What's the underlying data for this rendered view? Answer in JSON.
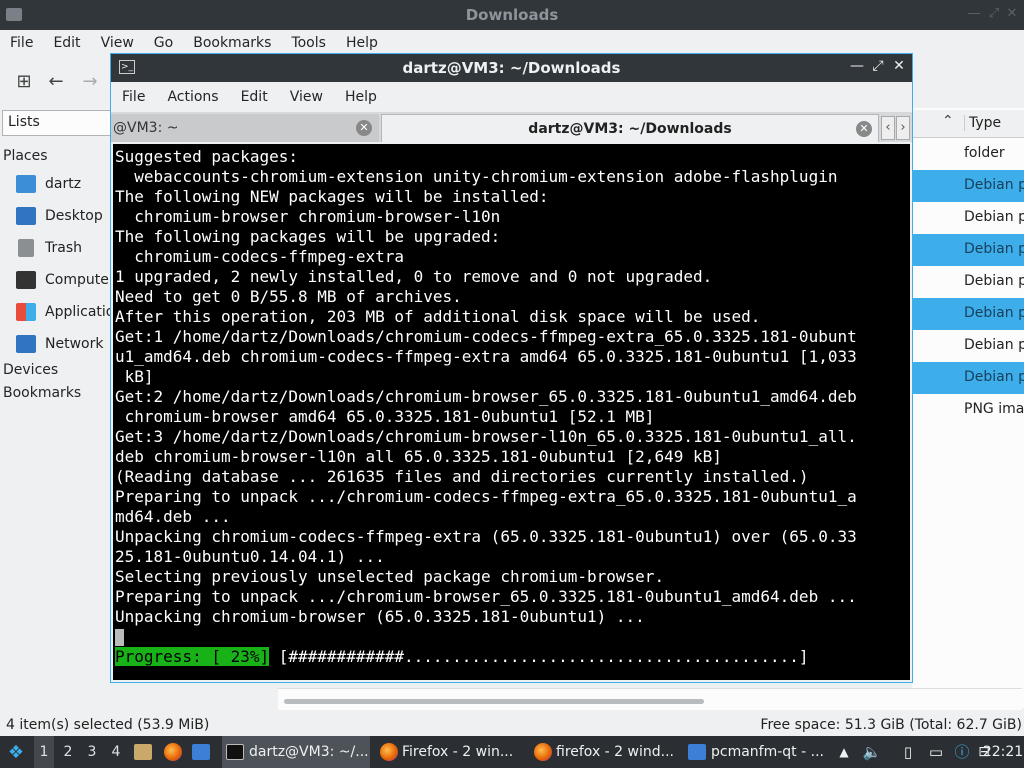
{
  "fm": {
    "title": "Downloads",
    "menu": [
      "File",
      "Edit",
      "View",
      "Go",
      "Bookmarks",
      "Tools",
      "Help"
    ],
    "lists_combo": "Lists",
    "places_heading": "Places",
    "places": [
      {
        "label": "dartz",
        "icon": "home-folder-icon",
        "color": "#3c8ed6"
      },
      {
        "label": "Desktop",
        "icon": "desktop-icon",
        "color": "#2f75c0"
      },
      {
        "label": "Trash",
        "icon": "trash-icon",
        "color": "#8a8f94"
      },
      {
        "label": "Computer",
        "icon": "computer-icon",
        "color": "#333333"
      },
      {
        "label": "Applications",
        "icon": "applications-icon",
        "color": "#e74c3c"
      },
      {
        "label": "Network",
        "icon": "network-icon",
        "color": "#2f75c0"
      }
    ],
    "devices_heading": "Devices",
    "bookmarks_heading": "Bookmarks",
    "type_header": "Type",
    "rows": [
      {
        "type": "folder",
        "selected": false
      },
      {
        "type": "Debian p",
        "selected": true
      },
      {
        "type": "Debian p",
        "selected": false
      },
      {
        "type": "Debian p",
        "selected": true
      },
      {
        "type": "Debian p",
        "selected": false
      },
      {
        "type": "Debian p",
        "selected": true
      },
      {
        "type": "Debian p",
        "selected": false
      },
      {
        "type": "Debian p",
        "selected": true
      },
      {
        "type": "PNG ima",
        "selected": false
      }
    ],
    "status_left": "4 item(s) selected (53.9 MiB)",
    "status_right": "Free space: 51.3 GiB (Total: 62.7 GiB)"
  },
  "term": {
    "title": "dartz@VM3: ~/Downloads",
    "menu": [
      "File",
      "Actions",
      "Edit",
      "View",
      "Help"
    ],
    "tab_inactive": "@VM3: ~",
    "tab_active": "dartz@VM3: ~/Downloads",
    "lines": [
      "Suggested packages:",
      "  webaccounts-chromium-extension unity-chromium-extension adobe-flashplugin",
      "The following NEW packages will be installed:",
      "  chromium-browser chromium-browser-l10n",
      "The following packages will be upgraded:",
      "  chromium-codecs-ffmpeg-extra",
      "1 upgraded, 2 newly installed, 0 to remove and 0 not upgraded.",
      "Need to get 0 B/55.8 MB of archives.",
      "After this operation, 203 MB of additional disk space will be used.",
      "Get:1 /home/dartz/Downloads/chromium-codecs-ffmpeg-extra_65.0.3325.181-0ubunt",
      "u1_amd64.deb chromium-codecs-ffmpeg-extra amd64 65.0.3325.181-0ubuntu1 [1,033",
      " kB]",
      "Get:2 /home/dartz/Downloads/chromium-browser_65.0.3325.181-0ubuntu1_amd64.deb",
      " chromium-browser amd64 65.0.3325.181-0ubuntu1 [52.1 MB]",
      "Get:3 /home/dartz/Downloads/chromium-browser-l10n_65.0.3325.181-0ubuntu1_all.",
      "deb chromium-browser-l10n all 65.0.3325.181-0ubuntu1 [2,649 kB]",
      "(Reading database ... 261635 files and directories currently installed.)",
      "Preparing to unpack .../chromium-codecs-ffmpeg-extra_65.0.3325.181-0ubuntu1_a",
      "md64.deb ...",
      "Unpacking chromium-codecs-ffmpeg-extra (65.0.3325.181-0ubuntu1) over (65.0.33",
      "25.181-0ubuntu0.14.04.1) ...",
      "Selecting previously unselected package chromium-browser.",
      "Preparing to unpack .../chromium-browser_65.0.3325.181-0ubuntu1_amd64.deb ...",
      "Unpacking chromium-browser (65.0.3325.181-0ubuntu1) ..."
    ],
    "progress_label": "Progress: [ 23%]",
    "progress_percent": 23,
    "progress_bar": " [############.........................................]",
    "colors": {
      "background": "#000000",
      "text": "#ffffff",
      "progress_bg": "#18b218"
    }
  },
  "taskbar": {
    "desktops": [
      "1",
      "2",
      "3",
      "4"
    ],
    "current_desktop": "1",
    "tasks": [
      {
        "label": "dartz@VM3: ~/...",
        "icon": "terminal-icon",
        "active": true
      },
      {
        "label": "Firefox - 2 win...",
        "icon": "firefox-icon",
        "active": false
      },
      {
        "label": "firefox - 2 wind...",
        "icon": "firefox-icon",
        "active": false
      },
      {
        "label": "pcmanfm-qt - ...",
        "icon": "folder-icon",
        "active": false
      }
    ],
    "clock": "22:21"
  }
}
